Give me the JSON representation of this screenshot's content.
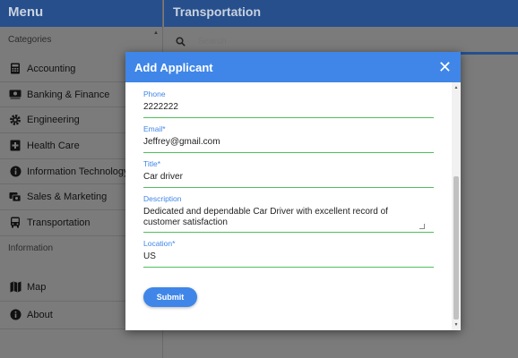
{
  "sidebar": {
    "title": "Menu",
    "categories_label": "Categories",
    "categories": [
      {
        "label": "Accounting",
        "icon": "calculator-icon"
      },
      {
        "label": "Banking & Finance",
        "icon": "money-icon"
      },
      {
        "label": "Engineering",
        "icon": "gear-icon"
      },
      {
        "label": "Health Care",
        "icon": "medical-icon"
      },
      {
        "label": "Information Technology",
        "icon": "info-icon"
      },
      {
        "label": "Sales & Marketing",
        "icon": "coins-icon"
      },
      {
        "label": "Transportation",
        "icon": "bus-icon"
      }
    ],
    "information_label": "Information",
    "info_items": [
      {
        "label": "Map",
        "icon": "map-icon"
      },
      {
        "label": "About",
        "icon": "info-icon"
      }
    ]
  },
  "header": {
    "title": "Transportation"
  },
  "search": {
    "placeholder": "Search"
  },
  "modal": {
    "title": "Add Applicant",
    "fields": [
      {
        "label": "Phone",
        "value": "2222222"
      },
      {
        "label": "Email*",
        "value": "Jeffrey@gmail.com"
      },
      {
        "label": "Title*",
        "value": "Car driver"
      },
      {
        "label": "Description",
        "value": "Dedicated and dependable Car Driver with excellent record of customer satisfaction"
      },
      {
        "label": "Location*",
        "value": "US"
      }
    ],
    "submit_label": "Submit"
  },
  "colors": {
    "header_bg": "#264f8c",
    "modal_header_bg": "#3f86e8",
    "field_underline": "#4fc05a",
    "overlay": "#7b7b7b"
  }
}
